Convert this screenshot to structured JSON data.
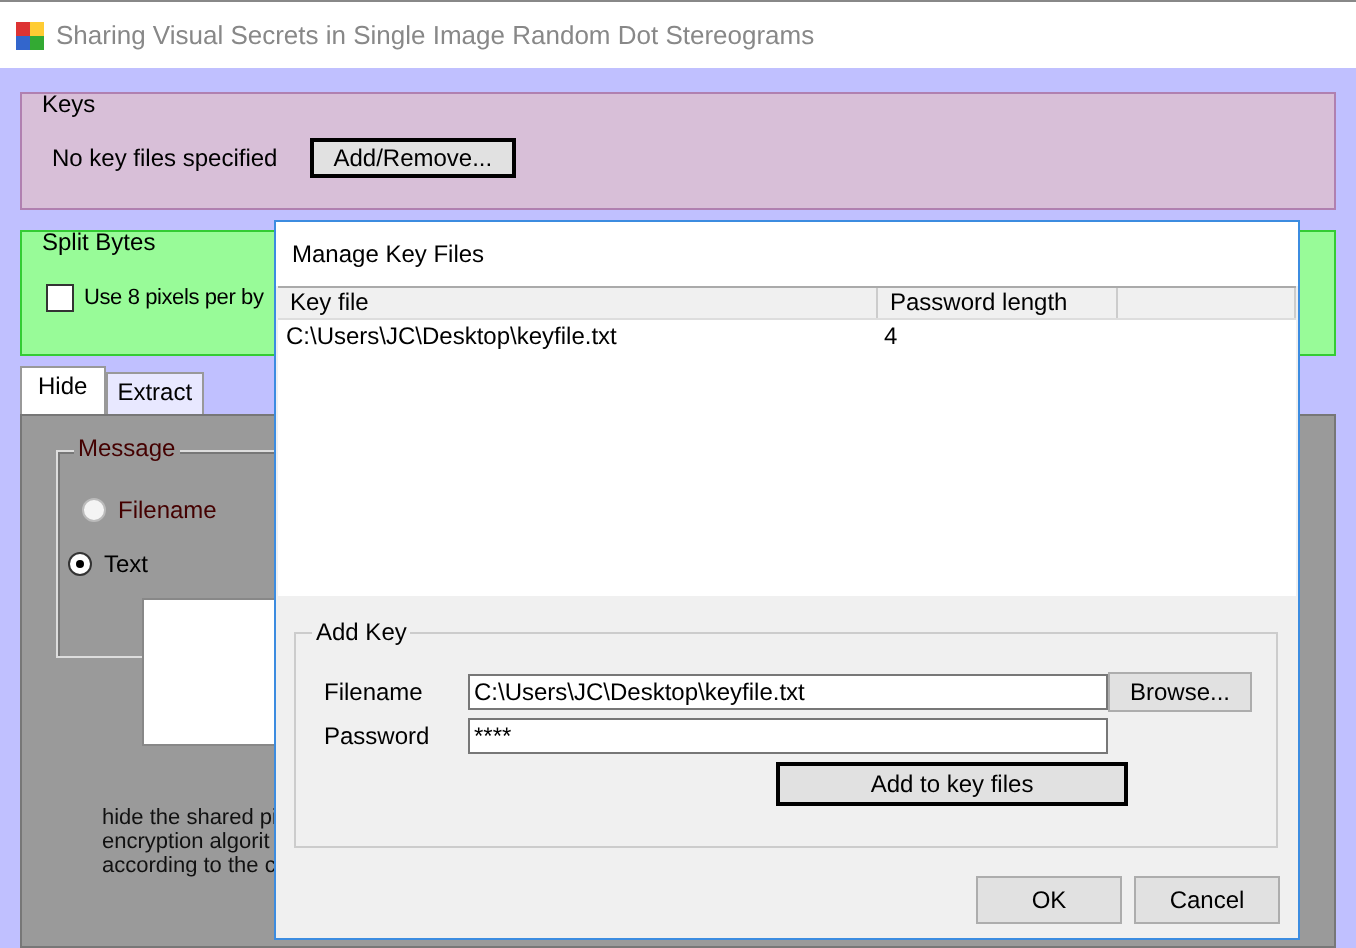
{
  "window": {
    "title": "Sharing Visual Secrets in Single Image Random Dot Stereograms"
  },
  "keys": {
    "title": "Keys",
    "status": "No key files specified",
    "button": "Add/Remove..."
  },
  "split_bytes": {
    "title": "Split Bytes",
    "checkbox": {
      "label": "Use 8 pixels per by",
      "checked": false
    }
  },
  "tabs": [
    {
      "label": "Hide",
      "selected": true
    },
    {
      "label": "Extract",
      "selected": false
    }
  ],
  "message": {
    "title": "Message",
    "options": [
      {
        "label": "Filename",
        "selected": false
      },
      {
        "label": "Text",
        "selected": true
      }
    ]
  },
  "description": [
    "hide the shared pi",
    "encryption algorit",
    "according to the c"
  ],
  "dialog": {
    "title": "Manage Key Files",
    "columns": [
      "Key file",
      "Password length"
    ],
    "rows": [
      [
        "C:\\Users\\JC\\Desktop\\keyfile.txt",
        "4"
      ]
    ],
    "add_key": {
      "title": "Add Key",
      "filename_label": "Filename",
      "filename": "C:\\Users\\JC\\Desktop\\keyfile.txt",
      "browse": "Browse...",
      "password_label": "Password",
      "password": "****",
      "add_button": "Add to key files"
    },
    "buttons": [
      "OK",
      "Cancel"
    ]
  }
}
